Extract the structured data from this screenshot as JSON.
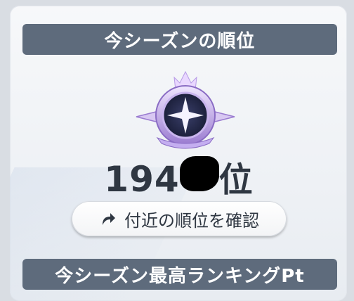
{
  "season_rank": {
    "header": "今シーズンの順位",
    "rank_number": "194",
    "rank_suffix": "位",
    "nearby_button_label": "付近の順位を確認"
  },
  "season_best": {
    "header": "今シーズン最高ランキングPt"
  },
  "icons": {
    "rank_emblem": "star-emblem-icon",
    "button_icon": "arrow-turn-icon"
  }
}
